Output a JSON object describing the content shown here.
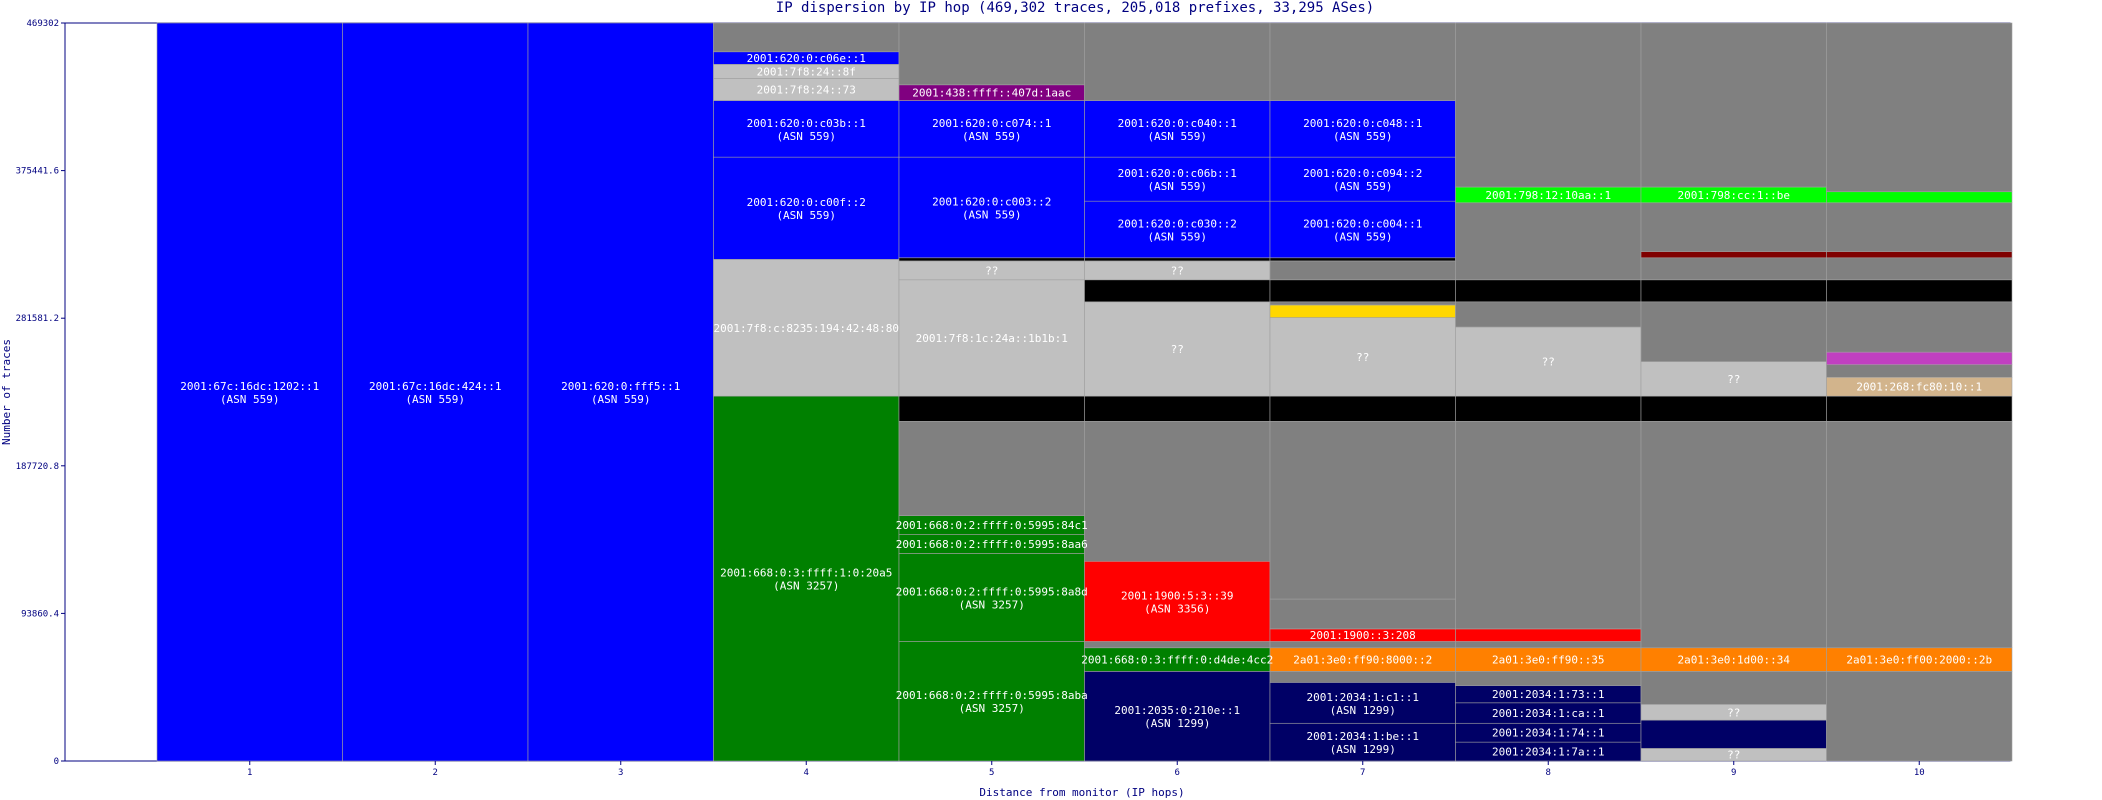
{
  "chart_data": {
    "type": "bar",
    "subtype": "stacked-column (IP dispersion)",
    "title": "IP dispersion by IP hop (469,302 traces, 205,018 prefixes, 33,295 ASes)",
    "xlabel": "Distance from monitor (IP hops)",
    "ylabel": "Number of traces",
    "ylim": [
      0,
      469302
    ],
    "yticks": [
      "0",
      "93860.4",
      "187720.8",
      "281581.2",
      "375441.6",
      "469302"
    ],
    "grid": false,
    "legend": "none",
    "categories": [
      "1",
      "2",
      "3",
      "4",
      "5",
      "6",
      "7",
      "8",
      "9",
      "10"
    ],
    "colors": {
      "axis": "#000080",
      "blue": "#0000ff",
      "green": "#008000",
      "navy": "#000066",
      "red": "#ff0000",
      "orange": "#ff8000",
      "gray": "#808080",
      "lightgray": "#c0c0c0",
      "black": "#000000",
      "purple": "#800080",
      "yellow": "#ffd700",
      "brightgreen": "#00ff00",
      "darkred": "#800000",
      "magenta": "#c040c0",
      "tan": "#d2b48c"
    },
    "columns": [
      {
        "hop": "1",
        "segments": [
          {
            "from": 0,
            "to": 469302,
            "color": "#0000ff",
            "label": "2001:67c:16dc:1202::1",
            "asn": "(ASN 559)"
          }
        ]
      },
      {
        "hop": "2",
        "segments": [
          {
            "from": 0,
            "to": 469302,
            "color": "#0000ff",
            "label": "2001:67c:16dc:424::1",
            "asn": "(ASN 559)"
          }
        ]
      },
      {
        "hop": "3",
        "segments": [
          {
            "from": 0,
            "to": 469302,
            "color": "#0000ff",
            "label": "2001:620:0:fff5::1",
            "asn": "(ASN 559)"
          }
        ]
      },
      {
        "hop": "4",
        "segments": [
          {
            "from": 0,
            "to": 232000,
            "color": "#008000",
            "label": "2001:668:0:3:ffff:1:0:20a5",
            "asn": "(ASN 3257)"
          },
          {
            "from": 232000,
            "to": 319000,
            "color": "#c0c0c0",
            "label": "2001:7f8:c:8235:194:42:48:80",
            "asn": ""
          },
          {
            "from": 319000,
            "to": 384000,
            "color": "#0000ff",
            "label": "2001:620:0:c00f::2",
            "asn": "(ASN 559)"
          },
          {
            "from": 384000,
            "to": 420000,
            "color": "#0000ff",
            "label": "2001:620:0:c03b::1",
            "asn": "(ASN 559)"
          },
          {
            "from": 420000,
            "to": 434000,
            "color": "#c0c0c0",
            "label": "2001:7f8:24::73",
            "asn": ""
          },
          {
            "from": 434000,
            "to": 443000,
            "color": "#c0c0c0",
            "label": "2001:7f8:24::8f",
            "asn": ""
          },
          {
            "from": 443000,
            "to": 451000,
            "color": "#0000ff",
            "label": "2001:620:0:c06e::1",
            "asn": ""
          },
          {
            "from": 451000,
            "to": 469302,
            "color": "#808080",
            "label": "",
            "asn": ""
          }
        ]
      },
      {
        "hop": "5",
        "segments": [
          {
            "from": 0,
            "to": 76000,
            "color": "#008000",
            "label": "2001:668:0:2:ffff:0:5995:8aba",
            "asn": "(ASN 3257)"
          },
          {
            "from": 76000,
            "to": 132000,
            "color": "#008000",
            "label": "2001:668:0:2:ffff:0:5995:8a8d",
            "asn": "(ASN 3257)"
          },
          {
            "from": 132000,
            "to": 144000,
            "color": "#008000",
            "label": "2001:668:0:2:ffff:0:5995:8aa6",
            "asn": ""
          },
          {
            "from": 144000,
            "to": 156000,
            "color": "#008000",
            "label": "2001:668:0:2:ffff:0:5995:84c1",
            "asn": ""
          },
          {
            "from": 156000,
            "to": 216000,
            "color": "#808080",
            "label": "",
            "asn": ""
          },
          {
            "from": 216000,
            "to": 232000,
            "color": "#000000",
            "label": "",
            "asn": ""
          },
          {
            "from": 232000,
            "to": 306000,
            "color": "#c0c0c0",
            "label": "2001:7f8:1c:24a::1b1b:1",
            "asn": ""
          },
          {
            "from": 306000,
            "to": 318000,
            "color": "#c0c0c0",
            "label": "??",
            "asn": ""
          },
          {
            "from": 318000,
            "to": 320000,
            "color": "#000000",
            "label": "",
            "asn": ""
          },
          {
            "from": 320000,
            "to": 384000,
            "color": "#0000ff",
            "label": "2001:620:0:c003::2",
            "asn": "(ASN 559)"
          },
          {
            "from": 384000,
            "to": 420000,
            "color": "#0000ff",
            "label": "2001:620:0:c074::1",
            "asn": "(ASN 559)"
          },
          {
            "from": 420000,
            "to": 430000,
            "color": "#800080",
            "label": "2001:438:ffff::407d:1aac",
            "asn": ""
          },
          {
            "from": 430000,
            "to": 469302,
            "color": "#808080",
            "label": "",
            "asn": ""
          }
        ]
      },
      {
        "hop": "6",
        "segments": [
          {
            "from": 0,
            "to": 57000,
            "color": "#000066",
            "label": "2001:2035:0:210e::1",
            "asn": "(ASN 1299)"
          },
          {
            "from": 57000,
            "to": 72000,
            "color": "#008000",
            "label": "2001:668:0:3:ffff:0:d4de:4cc2",
            "asn": ""
          },
          {
            "from": 72000,
            "to": 76000,
            "color": "#808080",
            "label": "",
            "asn": ""
          },
          {
            "from": 76000,
            "to": 127000,
            "color": "#ff0000",
            "label": "2001:1900:5:3::39",
            "asn": "(ASN 3356)"
          },
          {
            "from": 127000,
            "to": 216000,
            "color": "#808080",
            "label": "",
            "asn": ""
          },
          {
            "from": 216000,
            "to": 232000,
            "color": "#000000",
            "label": "",
            "asn": ""
          },
          {
            "from": 232000,
            "to": 292000,
            "color": "#c0c0c0",
            "label": "??",
            "asn": ""
          },
          {
            "from": 292000,
            "to": 306000,
            "color": "#000000",
            "label": "",
            "asn": ""
          },
          {
            "from": 306000,
            "to": 318000,
            "color": "#c0c0c0",
            "label": "??",
            "asn": ""
          },
          {
            "from": 318000,
            "to": 320000,
            "color": "#000000",
            "label": "",
            "asn": ""
          },
          {
            "from": 320000,
            "to": 356000,
            "color": "#0000ff",
            "label": "2001:620:0:c030::2",
            "asn": "(ASN 559)"
          },
          {
            "from": 356000,
            "to": 384000,
            "color": "#0000ff",
            "label": "2001:620:0:c06b::1",
            "asn": "(ASN 559)"
          },
          {
            "from": 384000,
            "to": 420000,
            "color": "#0000ff",
            "label": "2001:620:0:c040::1",
            "asn": "(ASN 559)"
          },
          {
            "from": 420000,
            "to": 469302,
            "color": "#808080",
            "label": "",
            "asn": ""
          }
        ]
      },
      {
        "hop": "7",
        "segments": [
          {
            "from": 0,
            "to": 24000,
            "color": "#000066",
            "label": "2001:2034:1:be::1",
            "asn": "(ASN 1299)"
          },
          {
            "from": 24000,
            "to": 50000,
            "color": "#000066",
            "label": "2001:2034:1:c1::1",
            "asn": "(ASN 1299)"
          },
          {
            "from": 50000,
            "to": 57000,
            "color": "#808080",
            "label": "",
            "asn": ""
          },
          {
            "from": 57000,
            "to": 72000,
            "color": "#ff8000",
            "label": "2a01:3e0:ff90:8000::2",
            "asn": ""
          },
          {
            "from": 72000,
            "to": 76000,
            "color": "#808080",
            "label": "",
            "asn": ""
          },
          {
            "from": 76000,
            "to": 84000,
            "color": "#ff0000",
            "label": "2001:1900::3:208",
            "asn": ""
          },
          {
            "from": 84000,
            "to": 103000,
            "color": "#808080",
            "label": "",
            "asn": ""
          },
          {
            "from": 103000,
            "to": 216000,
            "color": "#808080",
            "label": "",
            "asn": ""
          },
          {
            "from": 216000,
            "to": 232000,
            "color": "#000000",
            "label": "",
            "asn": ""
          },
          {
            "from": 232000,
            "to": 282000,
            "color": "#c0c0c0",
            "label": "??",
            "asn": ""
          },
          {
            "from": 282000,
            "to": 290000,
            "color": "#ffd700",
            "label": "",
            "asn": ""
          },
          {
            "from": 290000,
            "to": 292000,
            "color": "#808080",
            "label": "",
            "asn": ""
          },
          {
            "from": 292000,
            "to": 306000,
            "color": "#000000",
            "label": "",
            "asn": ""
          },
          {
            "from": 306000,
            "to": 318000,
            "color": "#808080",
            "label": "",
            "asn": ""
          },
          {
            "from": 318000,
            "to": 320000,
            "color": "#000000",
            "label": "",
            "asn": ""
          },
          {
            "from": 320000,
            "to": 356000,
            "color": "#0000ff",
            "label": "2001:620:0:c004::1",
            "asn": "(ASN 559)"
          },
          {
            "from": 356000,
            "to": 384000,
            "color": "#0000ff",
            "label": "2001:620:0:c094::2",
            "asn": "(ASN 559)"
          },
          {
            "from": 384000,
            "to": 420000,
            "color": "#0000ff",
            "label": "2001:620:0:c048::1",
            "asn": "(ASN 559)"
          },
          {
            "from": 420000,
            "to": 469302,
            "color": "#808080",
            "label": "",
            "asn": ""
          }
        ]
      },
      {
        "hop": "8",
        "segments": [
          {
            "from": 0,
            "to": 12000,
            "color": "#000066",
            "label": "2001:2034:1:7a::1",
            "asn": ""
          },
          {
            "from": 12000,
            "to": 24000,
            "color": "#000066",
            "label": "2001:2034:1:74::1",
            "asn": ""
          },
          {
            "from": 24000,
            "to": 37000,
            "color": "#000066",
            "label": "2001:2034:1:ca::1",
            "asn": ""
          },
          {
            "from": 37000,
            "to": 48000,
            "color": "#000066",
            "label": "2001:2034:1:73::1",
            "asn": ""
          },
          {
            "from": 48000,
            "to": 57000,
            "color": "#808080",
            "label": "",
            "asn": ""
          },
          {
            "from": 57000,
            "to": 72000,
            "color": "#ff8000",
            "label": "2a01:3e0:ff90::35",
            "asn": ""
          },
          {
            "from": 72000,
            "to": 76000,
            "color": "#808080",
            "label": "",
            "asn": ""
          },
          {
            "from": 76000,
            "to": 84000,
            "color": "#ff0000",
            "label": "",
            "asn": ""
          },
          {
            "from": 84000,
            "to": 216000,
            "color": "#808080",
            "label": "",
            "asn": ""
          },
          {
            "from": 216000,
            "to": 232000,
            "color": "#000000",
            "label": "",
            "asn": ""
          },
          {
            "from": 232000,
            "to": 276000,
            "color": "#c0c0c0",
            "label": "??",
            "asn": ""
          },
          {
            "from": 276000,
            "to": 292000,
            "color": "#808080",
            "label": "",
            "asn": ""
          },
          {
            "from": 292000,
            "to": 306000,
            "color": "#000000",
            "label": "",
            "asn": ""
          },
          {
            "from": 306000,
            "to": 355000,
            "color": "#808080",
            "label": "",
            "asn": ""
          },
          {
            "from": 355000,
            "to": 365000,
            "color": "#00ff00",
            "label": "2001:798:12:10aa::1",
            "asn": ""
          },
          {
            "from": 365000,
            "to": 469302,
            "color": "#808080",
            "label": "",
            "asn": ""
          }
        ]
      },
      {
        "hop": "9",
        "segments": [
          {
            "from": 0,
            "to": 8000,
            "color": "#c0c0c0",
            "label": "??",
            "asn": ""
          },
          {
            "from": 8000,
            "to": 26000,
            "color": "#000066",
            "label": "",
            "asn": ""
          },
          {
            "from": 26000,
            "to": 36000,
            "color": "#c0c0c0",
            "label": "??",
            "asn": ""
          },
          {
            "from": 36000,
            "to": 57000,
            "color": "#808080",
            "label": "",
            "asn": ""
          },
          {
            "from": 57000,
            "to": 72000,
            "color": "#ff8000",
            "label": "2a01:3e0:1d00::34",
            "asn": ""
          },
          {
            "from": 72000,
            "to": 216000,
            "color": "#808080",
            "label": "",
            "asn": ""
          },
          {
            "from": 216000,
            "to": 232000,
            "color": "#000000",
            "label": "",
            "asn": ""
          },
          {
            "from": 232000,
            "to": 254000,
            "color": "#c0c0c0",
            "label": "??",
            "asn": ""
          },
          {
            "from": 254000,
            "to": 292000,
            "color": "#808080",
            "label": "",
            "asn": ""
          },
          {
            "from": 292000,
            "to": 306000,
            "color": "#000000",
            "label": "",
            "asn": ""
          },
          {
            "from": 306000,
            "to": 320000,
            "color": "#808080",
            "label": "",
            "asn": ""
          },
          {
            "from": 320000,
            "to": 324000,
            "color": "#800000",
            "label": "",
            "asn": ""
          },
          {
            "from": 324000,
            "to": 355000,
            "color": "#808080",
            "label": "",
            "asn": ""
          },
          {
            "from": 355000,
            "to": 365000,
            "color": "#00ff00",
            "label": "2001:798:cc:1::be",
            "asn": ""
          },
          {
            "from": 365000,
            "to": 469302,
            "color": "#808080",
            "label": "",
            "asn": ""
          }
        ]
      },
      {
        "hop": "10",
        "segments": [
          {
            "from": 0,
            "to": 57000,
            "color": "#808080",
            "label": "",
            "asn": ""
          },
          {
            "from": 57000,
            "to": 72000,
            "color": "#ff8000",
            "label": "2a01:3e0:ff00:2000::2b",
            "asn": ""
          },
          {
            "from": 72000,
            "to": 216000,
            "color": "#808080",
            "label": "",
            "asn": ""
          },
          {
            "from": 216000,
            "to": 232000,
            "color": "#000000",
            "label": "",
            "asn": ""
          },
          {
            "from": 232000,
            "to": 244000,
            "color": "#d2b48c",
            "label": "2001:268:fc80:10::1",
            "asn": ""
          },
          {
            "from": 244000,
            "to": 252000,
            "color": "#808080",
            "label": "",
            "asn": ""
          },
          {
            "from": 252000,
            "to": 260000,
            "color": "#c040c0",
            "label": "",
            "asn": ""
          },
          {
            "from": 260000,
            "to": 292000,
            "color": "#808080",
            "label": "",
            "asn": ""
          },
          {
            "from": 292000,
            "to": 306000,
            "color": "#000000",
            "label": "",
            "asn": ""
          },
          {
            "from": 306000,
            "to": 320000,
            "color": "#808080",
            "label": "",
            "asn": ""
          },
          {
            "from": 320000,
            "to": 324000,
            "color": "#800000",
            "label": "",
            "asn": ""
          },
          {
            "from": 324000,
            "to": 355000,
            "color": "#808080",
            "label": "",
            "asn": ""
          },
          {
            "from": 355000,
            "to": 362000,
            "color": "#00ff00",
            "label": "",
            "asn": ""
          },
          {
            "from": 362000,
            "to": 469302,
            "color": "#808080",
            "label": "",
            "asn": ""
          }
        ]
      }
    ]
  }
}
